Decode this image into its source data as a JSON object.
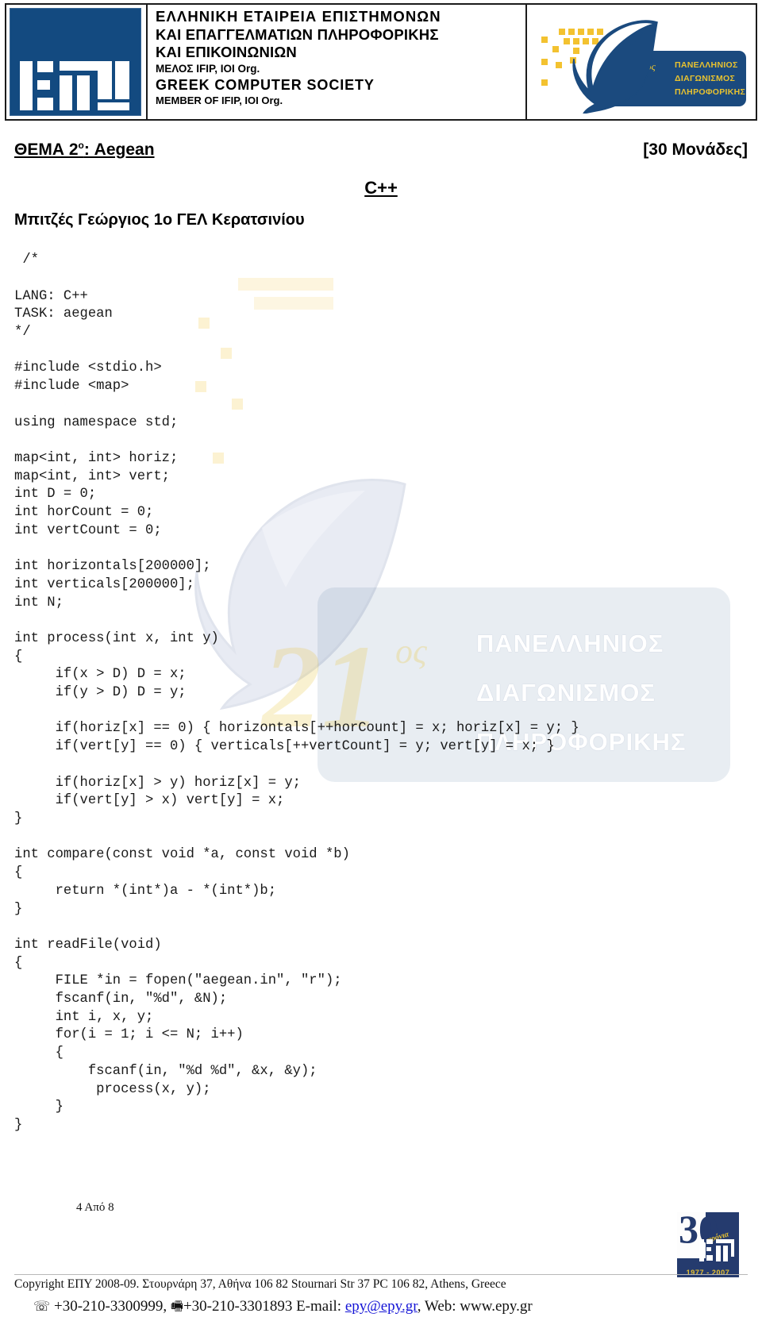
{
  "header": {
    "society_lines": [
      "ΕΛΛΗΝΙΚΗ  ΕΤΑΙΡΕΙΑ  ΕΠΙΣΤΗΜΟΝΩΝ",
      "ΚΑΙ ΕΠΑΓΓΕΛΜΑΤΙΩΝ  ΠΛΗΡΟΦΟΡΙΚΗΣ",
      "ΚΑΙ ΕΠΙΚΟΙΝΩΝΙΩΝ",
      "ΜΕΛΟΣ IFIP, IOI Org.",
      "GREEK COMPUTER SOCIETY",
      "MEMBER OF IFIP, IOI Org."
    ],
    "logo_alt": "epy-logo",
    "badge": {
      "number": "21",
      "ordinal": "ος",
      "lines": [
        "ΠΑΝΕΛΛΗΝΙΟΣ",
        "ΔΙΑΓΩΝΙΣΜΟΣ",
        "ΠΛΗΡΟΦΟΡΙΚΗΣ"
      ]
    }
  },
  "title": {
    "thema_prefix": "ΘΕΜΑ 2",
    "thema_sup": "ο",
    "thema_suffix": ": Aegean",
    "points": "[30 Μονάδες]",
    "language": "C++",
    "author": "Μπιτζές Γεώργιος 1ο ΓΕΛ Κερατσινίου"
  },
  "code": {
    "language": "C++",
    "task": "aegean",
    "text": " /*\n\nLANG: C++\nTASK: aegean\n*/\n\n#include <stdio.h>\n#include <map>\n\nusing namespace std;\n\nmap<int, int> horiz;\nmap<int, int> vert;\nint D = 0;\nint horCount = 0;\nint vertCount = 0;\n\nint horizontals[200000];\nint verticals[200000];\nint N;\n\nint process(int x, int y)\n{\n     if(x > D) D = x;\n     if(y > D) D = y;\n\n     if(horiz[x] == 0) { horizontals[++horCount] = x; horiz[x] = y; }\n     if(vert[y] == 0) { verticals[++vertCount] = y; vert[y] = x; }\n\n     if(horiz[x] > y) horiz[x] = y;\n     if(vert[y] > x) vert[y] = x;\n}\n\nint compare(const void *a, const void *b)\n{\n     return *(int*)a - *(int*)b;\n}\n\nint readFile(void)\n{\n     FILE *in = fopen(\"aegean.in\", \"r\");\n     fscanf(in, \"%d\", &N);\n     int i, x, y;\n     for(i = 1; i <= N; i++)\n     {\n         fscanf(in, \"%d %d\", &x, &y);\n          process(x, y);\n     }\n}"
  },
  "page": {
    "label": "4 Από 8"
  },
  "anniversary_logo": {
    "number": "30",
    "chronia": "χρόνια",
    "years": "1977 - 2007"
  },
  "footer": {
    "line1": "Copyright ΕΠΥ 2008-09. Στουρνάρη 37, Αθήνα 106 82 Stournari Str 37 PC 106 82, Athens, Greece",
    "phone_glyph": "☏",
    "phone": "+30-210-3300999,",
    "fax_glyph": "🖷",
    "fax": "+30-210-3301893",
    "email_label": "E-mail:",
    "email": "epy@epy.gr",
    "web_label": ", Web:",
    "web": "www.epy.gr"
  },
  "colors": {
    "brand_blue": "#134a80",
    "badge_blue": "#1b4a7e",
    "gold": "#e8c230",
    "link": "#1414d6"
  }
}
